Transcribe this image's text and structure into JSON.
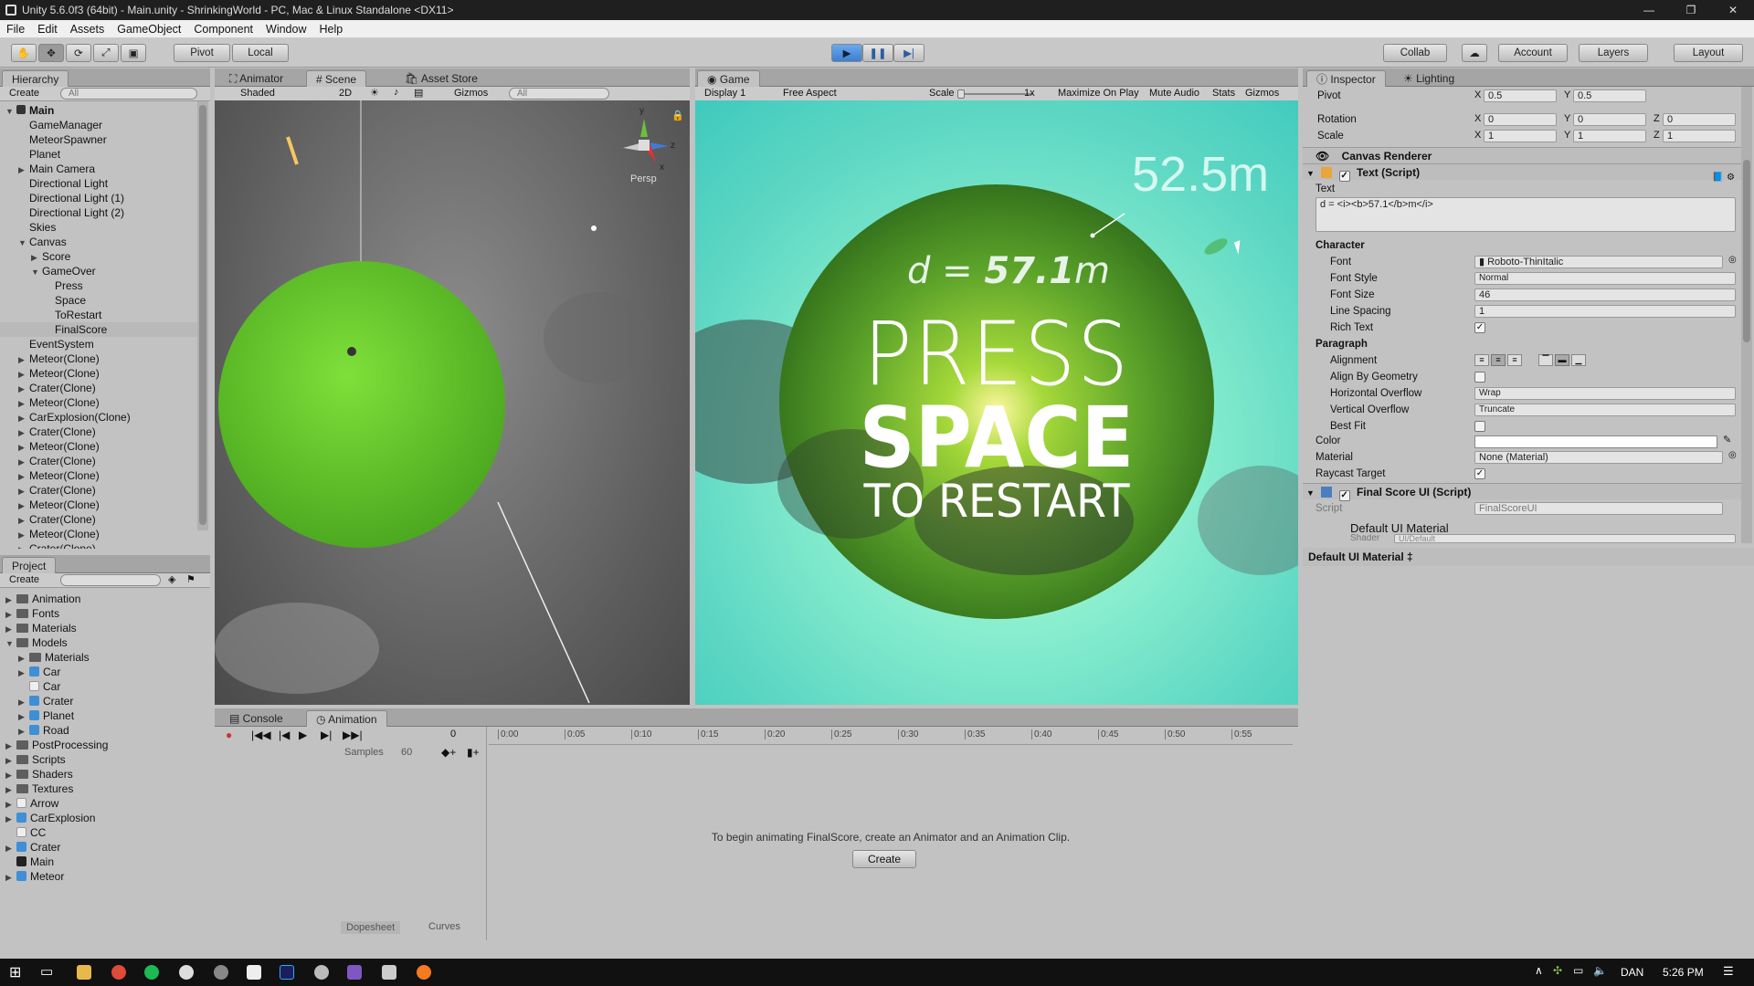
{
  "window": {
    "title": "Unity 5.6.0f3 (64bit) - Main.unity - ShrinkingWorld - PC, Mac & Linux Standalone <DX11>"
  },
  "menu": [
    "File",
    "Edit",
    "Assets",
    "GameObject",
    "Component",
    "Window",
    "Help"
  ],
  "toolbar": {
    "pivot": "Pivot",
    "local": "Local",
    "collab": "Collab",
    "account": "Account",
    "layers": "Layers",
    "layout": "Layout"
  },
  "hierarchy": {
    "tab": "Hierarchy",
    "create": "Create",
    "search_placeholder": "All",
    "scene": "Main",
    "items": [
      {
        "label": "GameManager",
        "indent": 1,
        "arrow": ""
      },
      {
        "label": "MeteorSpawner",
        "indent": 1,
        "arrow": ""
      },
      {
        "label": "Planet",
        "indent": 1,
        "arrow": ""
      },
      {
        "label": "Main Camera",
        "indent": 1,
        "arrow": "▶"
      },
      {
        "label": "Directional Light",
        "indent": 1,
        "arrow": ""
      },
      {
        "label": "Directional Light (1)",
        "indent": 1,
        "arrow": ""
      },
      {
        "label": "Directional Light (2)",
        "indent": 1,
        "arrow": ""
      },
      {
        "label": "Skies",
        "indent": 1,
        "arrow": ""
      },
      {
        "label": "Canvas",
        "indent": 1,
        "arrow": "▼"
      },
      {
        "label": "Score",
        "indent": 2,
        "arrow": "▶"
      },
      {
        "label": "GameOver",
        "indent": 2,
        "arrow": "▼"
      },
      {
        "label": "Press",
        "indent": 3,
        "arrow": ""
      },
      {
        "label": "Space",
        "indent": 3,
        "arrow": ""
      },
      {
        "label": "ToRestart",
        "indent": 3,
        "arrow": ""
      },
      {
        "label": "FinalScore",
        "indent": 3,
        "arrow": "",
        "selected": true
      },
      {
        "label": "EventSystem",
        "indent": 1,
        "arrow": ""
      },
      {
        "label": "Meteor(Clone)",
        "indent": 1,
        "arrow": "▶"
      },
      {
        "label": "Meteor(Clone)",
        "indent": 1,
        "arrow": "▶"
      },
      {
        "label": "Crater(Clone)",
        "indent": 1,
        "arrow": "▶"
      },
      {
        "label": "Meteor(Clone)",
        "indent": 1,
        "arrow": "▶"
      },
      {
        "label": "CarExplosion(Clone)",
        "indent": 1,
        "arrow": "▶"
      },
      {
        "label": "Crater(Clone)",
        "indent": 1,
        "arrow": "▶"
      },
      {
        "label": "Meteor(Clone)",
        "indent": 1,
        "arrow": "▶"
      },
      {
        "label": "Crater(Clone)",
        "indent": 1,
        "arrow": "▶"
      },
      {
        "label": "Meteor(Clone)",
        "indent": 1,
        "arrow": "▶"
      },
      {
        "label": "Crater(Clone)",
        "indent": 1,
        "arrow": "▶"
      },
      {
        "label": "Meteor(Clone)",
        "indent": 1,
        "arrow": "▶"
      },
      {
        "label": "Crater(Clone)",
        "indent": 1,
        "arrow": "▶"
      },
      {
        "label": "Meteor(Clone)",
        "indent": 1,
        "arrow": "▶"
      },
      {
        "label": "Crater(Clone)",
        "indent": 1,
        "arrow": "▶"
      }
    ]
  },
  "project": {
    "tab": "Project",
    "create": "Create",
    "items": [
      {
        "label": "Animation",
        "indent": 0,
        "arrow": "▶",
        "icon": "folder"
      },
      {
        "label": "Fonts",
        "indent": 0,
        "arrow": "▶",
        "icon": "folder"
      },
      {
        "label": "Materials",
        "indent": 0,
        "arrow": "▶",
        "icon": "folder"
      },
      {
        "label": "Models",
        "indent": 0,
        "arrow": "▼",
        "icon": "folder"
      },
      {
        "label": "Materials",
        "indent": 1,
        "arrow": "▶",
        "icon": "folder"
      },
      {
        "label": "Car",
        "indent": 1,
        "arrow": "▶",
        "icon": "cube"
      },
      {
        "label": "Car",
        "indent": 1,
        "arrow": "",
        "icon": "file"
      },
      {
        "label": "Crater",
        "indent": 1,
        "arrow": "▶",
        "icon": "cube"
      },
      {
        "label": "Planet",
        "indent": 1,
        "arrow": "▶",
        "icon": "cube"
      },
      {
        "label": "Road",
        "indent": 1,
        "arrow": "▶",
        "icon": "cube"
      },
      {
        "label": "PostProcessing",
        "indent": 0,
        "arrow": "▶",
        "icon": "folder"
      },
      {
        "label": "Scripts",
        "indent": 0,
        "arrow": "▶",
        "icon": "folder"
      },
      {
        "label": "Shaders",
        "indent": 0,
        "arrow": "▶",
        "icon": "folder"
      },
      {
        "label": "Textures",
        "indent": 0,
        "arrow": "▶",
        "icon": "folder"
      },
      {
        "label": "Arrow",
        "indent": 0,
        "arrow": "▶",
        "icon": "file"
      },
      {
        "label": "CarExplosion",
        "indent": 0,
        "arrow": "▶",
        "icon": "cube"
      },
      {
        "label": "CC",
        "indent": 0,
        "arrow": "",
        "icon": "file"
      },
      {
        "label": "Crater",
        "indent": 0,
        "arrow": "▶",
        "icon": "cube"
      },
      {
        "label": "Main",
        "indent": 0,
        "arrow": "",
        "icon": "unity"
      },
      {
        "label": "Meteor",
        "indent": 0,
        "arrow": "▶",
        "icon": "cube"
      }
    ]
  },
  "scene": {
    "tabs": [
      "Animator",
      "Scene",
      "Asset Store"
    ],
    "shading": "Shaded",
    "mode2d": "2D",
    "gizmos": "Gizmos",
    "search_placeholder": "All",
    "persp": "Persp",
    "axes": {
      "y": "y",
      "x": "x",
      "z": "z"
    }
  },
  "game": {
    "tab": "Game",
    "display": "Display 1",
    "aspect": "Free Aspect",
    "scale_label": "Scale",
    "scale_value": "1x",
    "maximize": "Maximize On Play",
    "mute": "Mute Audio",
    "stats": "Stats",
    "gizmos": "Gizmos",
    "overlay": {
      "distance": "52.5m",
      "d_prefix": "d = ",
      "d_value": "57.1",
      "d_unit": "m",
      "press": "PRESS",
      "space": "SPACE",
      "restart": "TO RESTART"
    }
  },
  "animation": {
    "tabs": [
      "Console",
      "Animation"
    ],
    "samples_label": "Samples",
    "samples_value": "60",
    "frame": "0",
    "ticks": [
      "0:00",
      "0:05",
      "0:10",
      "0:15",
      "0:20",
      "0:25",
      "0:30",
      "0:35",
      "0:40",
      "0:45",
      "0:50",
      "0:55"
    ],
    "message": "To begin animating FinalScore, create an Animator and an Animation Clip.",
    "create": "Create",
    "dopesheet": "Dopesheet",
    "curves": "Curves"
  },
  "inspector": {
    "tabs": [
      "Inspector",
      "Lighting"
    ],
    "pivot": {
      "label": "Pivot",
      "x": "0.5",
      "y": "0.5"
    },
    "rotation": {
      "label": "Rotation",
      "x": "0",
      "y": "0",
      "z": "0"
    },
    "scale": {
      "label": "Scale",
      "x": "1",
      "y": "1",
      "z": "1"
    },
    "canvas_renderer": "Canvas Renderer",
    "text_script": "Text (Script)",
    "text_label": "Text",
    "text_value": "d = <i><b>57.1</b>m</i>",
    "character": "Character",
    "font": {
      "label": "Font",
      "value": "Roboto-ThinItalic"
    },
    "font_style": {
      "label": "Font Style",
      "value": "Normal"
    },
    "font_size": {
      "label": "Font Size",
      "value": "46"
    },
    "line_spacing": {
      "label": "Line Spacing",
      "value": "1"
    },
    "rich_text": {
      "label": "Rich Text",
      "checked": true
    },
    "paragraph": "Paragraph",
    "alignment": {
      "label": "Alignment"
    },
    "align_by_geometry": {
      "label": "Align By Geometry"
    },
    "horizontal_overflow": {
      "label": "Horizontal Overflow",
      "value": "Wrap"
    },
    "vertical_overflow": {
      "label": "Vertical Overflow",
      "value": "Truncate"
    },
    "best_fit": {
      "label": "Best Fit"
    },
    "color": {
      "label": "Color",
      "value": "#ffffff"
    },
    "material": {
      "label": "Material",
      "value": "None (Material)"
    },
    "raycast": {
      "label": "Raycast Target",
      "checked": true
    },
    "final_score_script": "Final Score UI (Script)",
    "script": {
      "label": "Script",
      "value": "FinalScoreUI"
    },
    "default_material": "Default UI Material",
    "shader_label": "Shader",
    "shader_value": "UI/Default",
    "footer": "Default UI Material ‡"
  },
  "taskbar": {
    "lang": "DAN",
    "time": "5:26 PM"
  },
  "colors": {
    "accent": "#3d8ee0",
    "game_bg": "#5fd8c4",
    "planet": "#5fbf2e",
    "scene_sphere": "#6acd2d"
  }
}
